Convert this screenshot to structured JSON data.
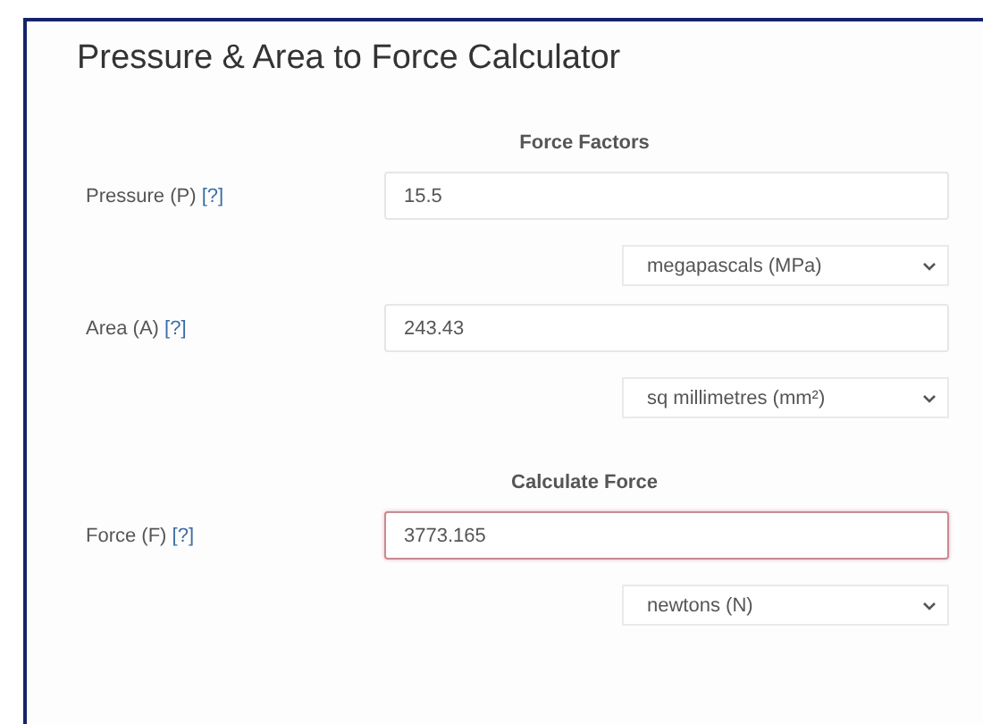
{
  "title": "Pressure & Area to Force Calculator",
  "sections": [
    {
      "heading": "Force Factors",
      "rows": [
        {
          "label": "Pressure (P)",
          "help": "[?]",
          "value": "15.5",
          "unit": "megapascals (MPa)",
          "highlighted": false
        },
        {
          "label": "Area (A)",
          "help": "[?]",
          "value": "243.43",
          "unit": "sq millimetres (mm²)",
          "highlighted": false
        }
      ]
    },
    {
      "heading": "Calculate Force",
      "rows": [
        {
          "label": "Force (F)",
          "help": "[?]",
          "value": "3773.165",
          "unit": "newtons (N)",
          "highlighted": true
        }
      ]
    }
  ]
}
